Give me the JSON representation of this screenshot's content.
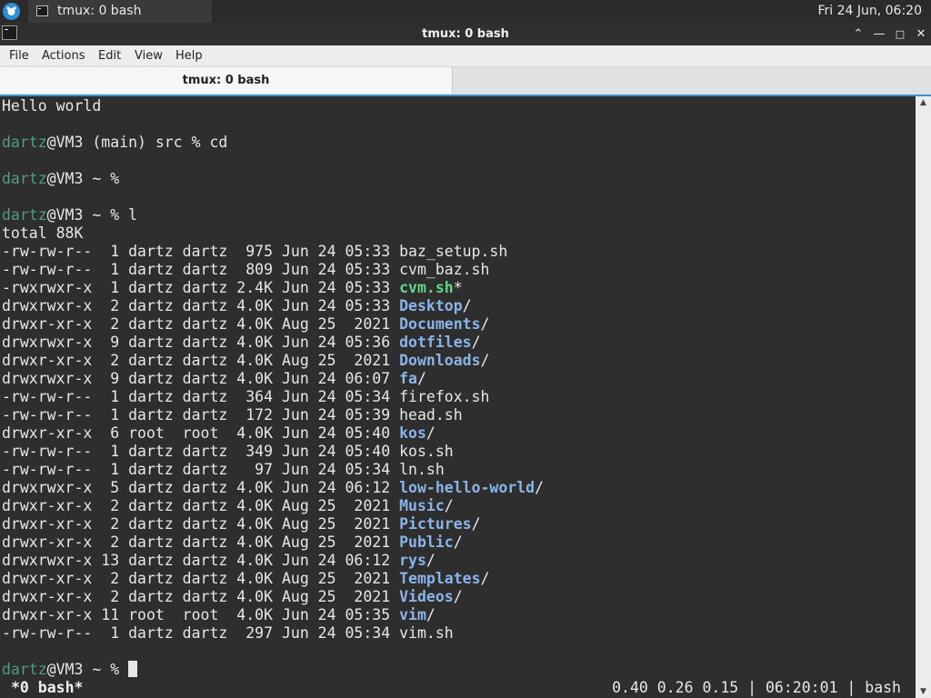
{
  "panel": {
    "task_title": "tmux: 0 bash",
    "clock": "Fri 24 Jun, 06:20",
    "launcher_icon": "xfce-mouse-icon",
    "task_icon": "terminal-icon"
  },
  "window": {
    "title": "tmux: 0 bash",
    "buttons": [
      "maximize-up-icon",
      "minimize-icon",
      "restore-icon",
      "close-icon"
    ]
  },
  "menu": {
    "file": "File",
    "actions": "Actions",
    "edit": "Edit",
    "view": "View",
    "help": "Help"
  },
  "tab": {
    "label": "tmux: 0 bash"
  },
  "terminal": {
    "colors": {
      "background": "#2e2e2e",
      "text": "#e7e7e7",
      "user": "#4a9d86",
      "directory": "#8ab4e8",
      "executable": "#5fd48b"
    },
    "lines": [
      {
        "text": "Hello world"
      },
      {
        "text": ""
      },
      {
        "user": "dartz",
        "text": "@VM3 (main) src % cd"
      },
      {
        "text": ""
      },
      {
        "user": "dartz",
        "text": "@VM3 ~ %"
      },
      {
        "text": ""
      },
      {
        "user": "dartz",
        "text": "@VM3 ~ % l"
      },
      {
        "text": "total 88K"
      },
      {
        "text": "-rw-rw-r--  1 dartz dartz  975 Jun 24 05:33 baz_setup.sh"
      },
      {
        "text": "-rw-rw-r--  1 dartz dartz  809 Jun 24 05:33 cvm_baz.sh"
      },
      {
        "text": "-rwxrwxr-x  1 dartz dartz 2.4K Jun 24 05:33 ",
        "exe": "cvm.sh",
        "suffix": "*"
      },
      {
        "text": "drwxrwxr-x  2 dartz dartz 4.0K Jun 24 05:33 ",
        "dir": "Desktop",
        "suffix": "/"
      },
      {
        "text": "drwxr-xr-x  2 dartz dartz 4.0K Aug 25  2021 ",
        "dir": "Documents",
        "suffix": "/"
      },
      {
        "text": "drwxrwxr-x  9 dartz dartz 4.0K Jun 24 05:36 ",
        "dir": "dotfiles",
        "suffix": "/"
      },
      {
        "text": "drwxr-xr-x  2 dartz dartz 4.0K Aug 25  2021 ",
        "dir": "Downloads",
        "suffix": "/"
      },
      {
        "text": "drwxrwxr-x  9 dartz dartz 4.0K Jun 24 06:07 ",
        "dir": "fa",
        "suffix": "/"
      },
      {
        "text": "-rw-rw-r--  1 dartz dartz  364 Jun 24 05:34 firefox.sh"
      },
      {
        "text": "-rw-rw-r--  1 dartz dartz  172 Jun 24 05:39 head.sh"
      },
      {
        "text": "drwxr-xr-x  6 root  root  4.0K Jun 24 05:40 ",
        "dir": "kos",
        "suffix": "/"
      },
      {
        "text": "-rw-rw-r--  1 dartz dartz  349 Jun 24 05:40 kos.sh"
      },
      {
        "text": "-rw-rw-r--  1 dartz dartz   97 Jun 24 05:34 ln.sh"
      },
      {
        "text": "drwxrwxr-x  5 dartz dartz 4.0K Jun 24 06:12 ",
        "dir": "low-hello-world",
        "suffix": "/"
      },
      {
        "text": "drwxr-xr-x  2 dartz dartz 4.0K Aug 25  2021 ",
        "dir": "Music",
        "suffix": "/"
      },
      {
        "text": "drwxr-xr-x  2 dartz dartz 4.0K Aug 25  2021 ",
        "dir": "Pictures",
        "suffix": "/"
      },
      {
        "text": "drwxr-xr-x  2 dartz dartz 4.0K Aug 25  2021 ",
        "dir": "Public",
        "suffix": "/"
      },
      {
        "text": "drwxrwxr-x 13 dartz dartz 4.0K Jun 24 06:12 ",
        "dir": "rys",
        "suffix": "/"
      },
      {
        "text": "drwxr-xr-x  2 dartz dartz 4.0K Aug 25  2021 ",
        "dir": "Templates",
        "suffix": "/"
      },
      {
        "text": "drwxr-xr-x  2 dartz dartz 4.0K Aug 25  2021 ",
        "dir": "Videos",
        "suffix": "/"
      },
      {
        "text": "drwxr-xr-x 11 root  root  4.0K Jun 24 05:35 ",
        "dir": "vim",
        "suffix": "/"
      },
      {
        "text": "-rw-rw-r--  1 dartz dartz  297 Jun 24 05:34 vim.sh"
      },
      {
        "text": ""
      },
      {
        "user": "dartz",
        "text": "@VM3 ~ % ",
        "cursor": true
      }
    ]
  },
  "tmux_status": {
    "left": "*0 bash*",
    "right": "0.40 0.26 0.15 | 06:20:01 | bash"
  }
}
